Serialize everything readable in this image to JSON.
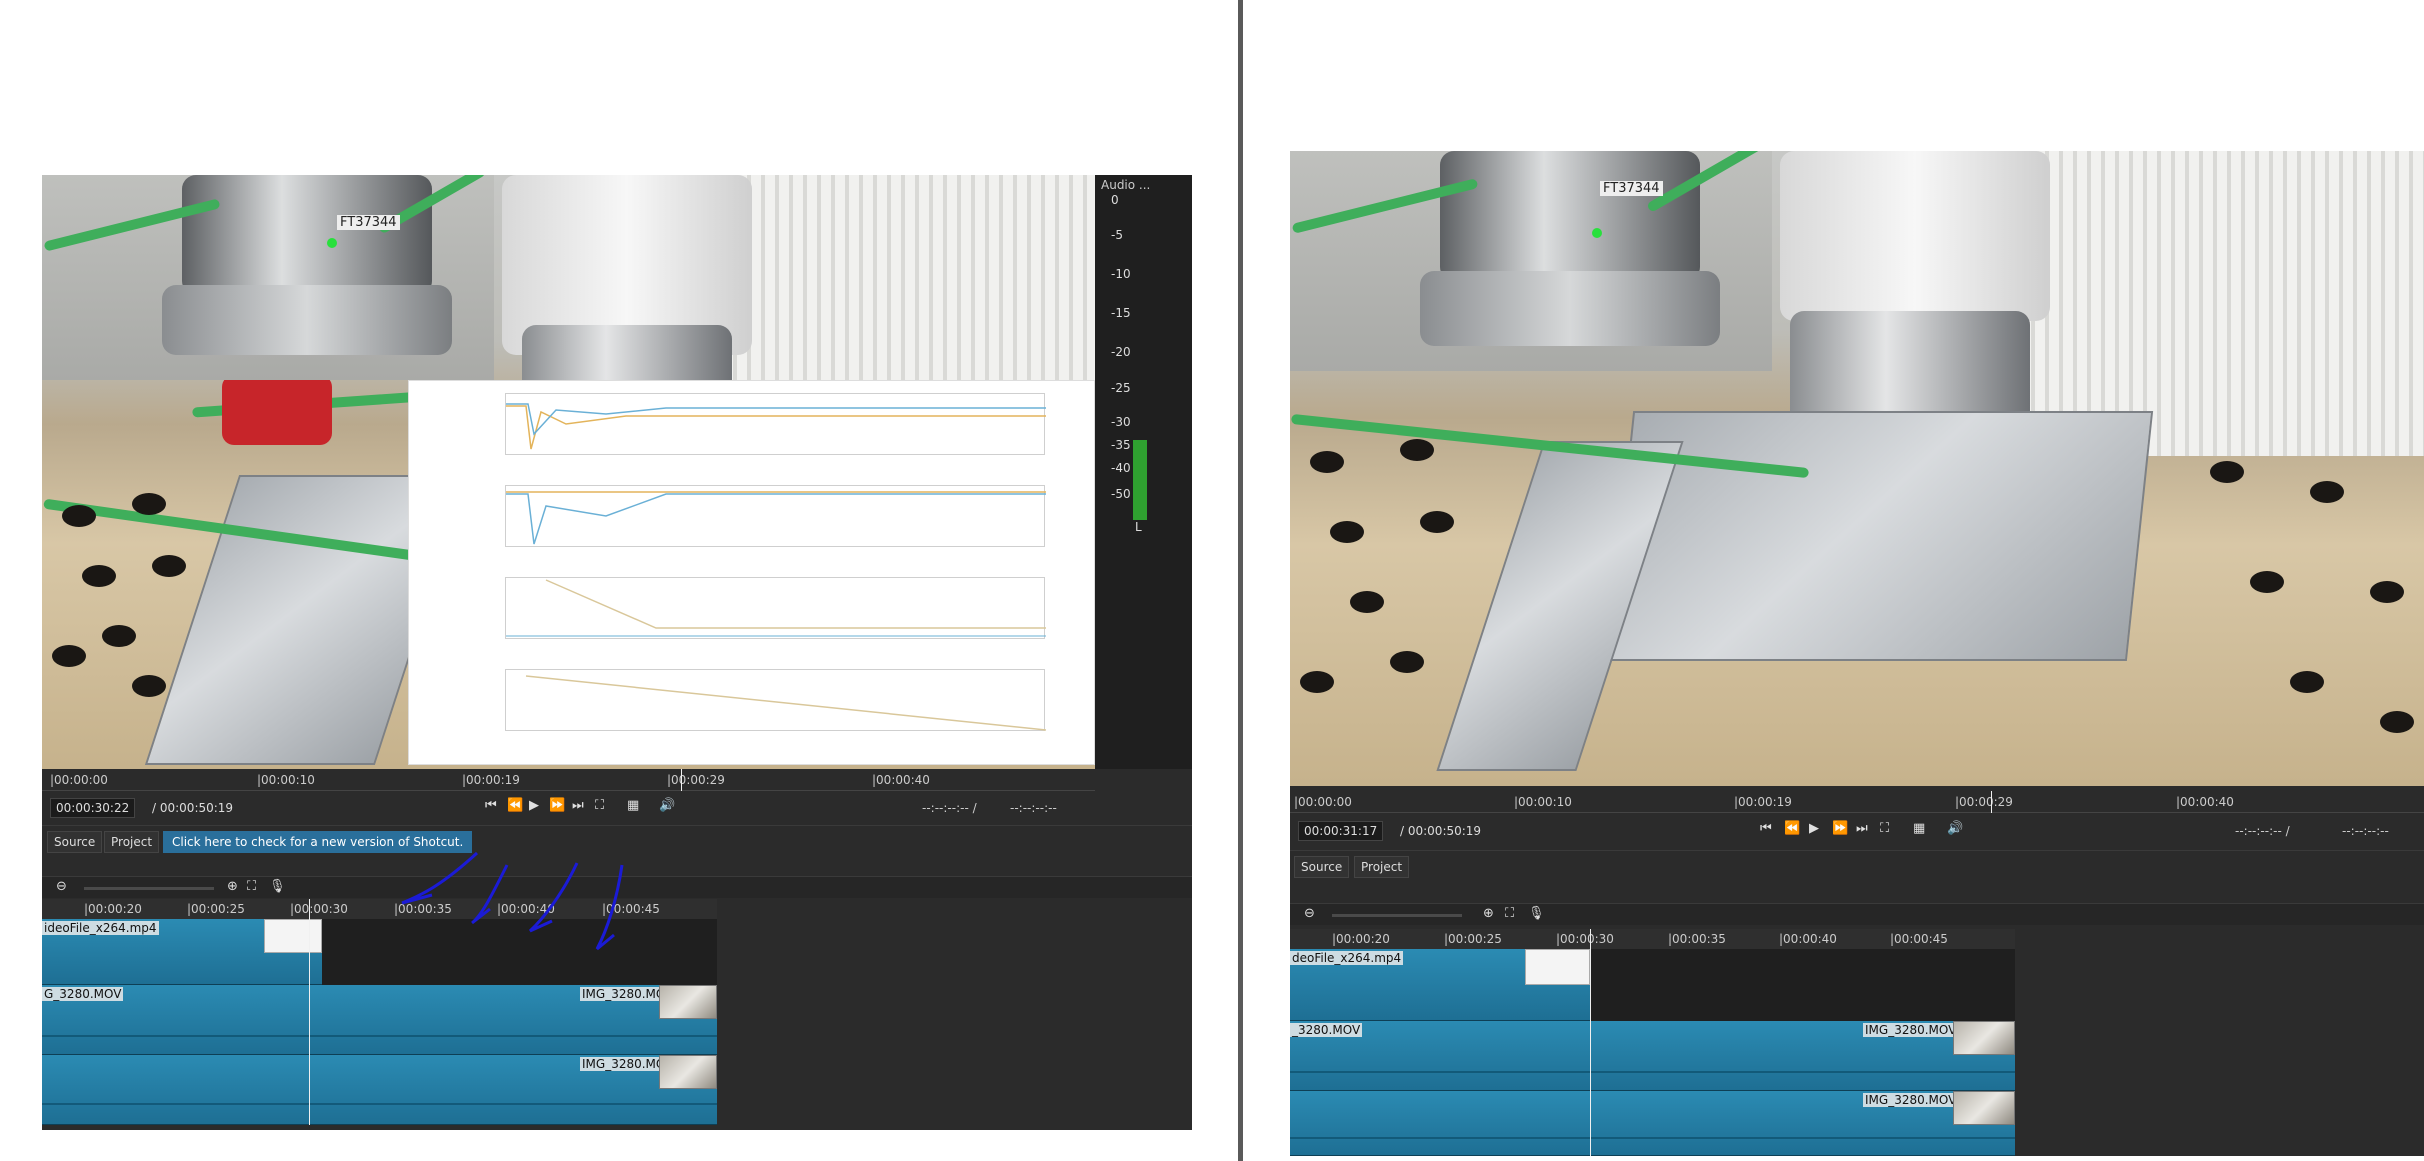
{
  "left": {
    "ruler_ticks": [
      "|00:00:00",
      "|00:00:10",
      "|00:00:19",
      "|00:00:29",
      "|00:00:40"
    ],
    "timecode_current": "00:00:30:22",
    "timecode_total": "/ 00:00:50:19",
    "in_out": "--:--:--:-- /",
    "out": "--:--:--:--",
    "tabs": [
      "Source",
      "Project"
    ],
    "update_banner": "Click here to check for a new version of Shotcut.",
    "timeline_ticks": [
      "|00:00:20",
      "|00:00:25",
      "|00:00:30",
      "|00:00:35",
      "|00:00:40",
      "|00:00:45"
    ],
    "clips": {
      "v2": "ideoFile_x264.mp4",
      "v1_left": "G_3280.MOV",
      "v1_right": "IMG_3280.MOV",
      "a1_right": "IMG_3280.MOV"
    },
    "audio": {
      "title": "Audio ...",
      "scale": [
        "0",
        "-5",
        "-10",
        "-15",
        "-20",
        "-25",
        "-30",
        "-35",
        "-40",
        "-50"
      ],
      "channel": "L",
      "level_fraction": 0.42
    },
    "video_stamp": "FT37344"
  },
  "right": {
    "ruler_ticks": [
      "|00:00:00",
      "|00:00:10",
      "|00:00:19",
      "|00:00:29",
      "|00:00:40"
    ],
    "timecode_current": "00:00:31:17",
    "timecode_total": "/ 00:00:50:19",
    "in_out": "--:--:--:-- /",
    "out": "--:--:--:--",
    "tabs": [
      "Source",
      "Project"
    ],
    "timeline_ticks": [
      "|00:00:20",
      "|00:00:25",
      "|00:00:30",
      "|00:00:35",
      "|00:00:40",
      "|00:00:45"
    ],
    "clips": {
      "v2": "deoFile_x264.mp4",
      "v1_left": "_3280.MOV",
      "v1_right": "IMG_3280.MOV",
      "a1_right": "IMG_3280.MOV"
    },
    "video_stamp": "FT37344"
  },
  "colors": {
    "clip": "#2b8bb3",
    "update": "#2a6f9b",
    "pen": "#1b1bd6",
    "meter": "#2fa030"
  }
}
